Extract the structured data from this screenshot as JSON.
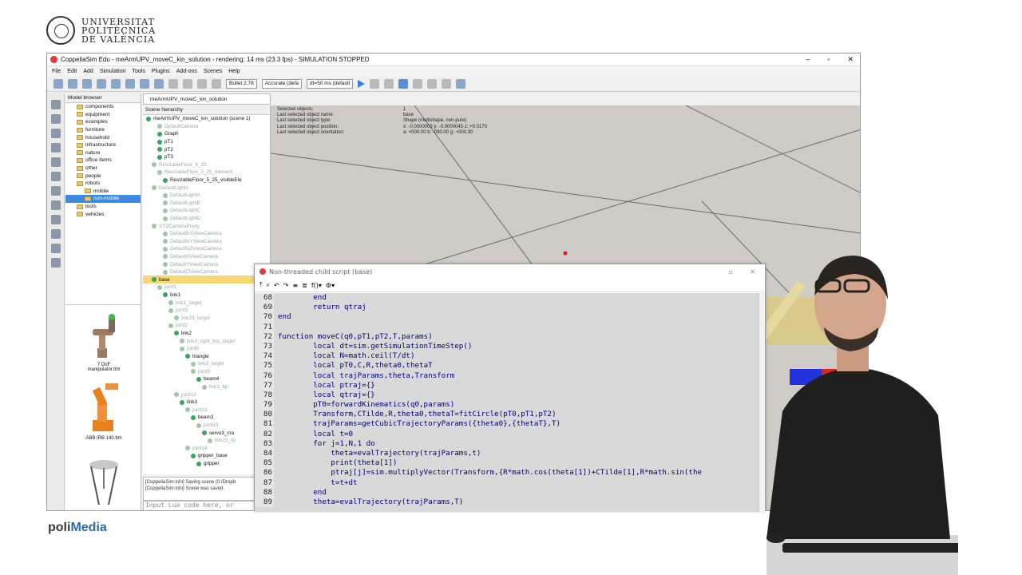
{
  "brand": {
    "university_lines": [
      "UNIVERSITAT",
      "POLITÈCNICA",
      "DE VALÈNCIA"
    ],
    "polimedia_a": "poli",
    "polimedia_b": "Media"
  },
  "window": {
    "title": "CoppeliaSim Edu - meArmUPV_moveC_kin_solution - rendering: 14 ms (23.3 fps) - SIMULATION STOPPED"
  },
  "menu": [
    "File",
    "Edit",
    "Add",
    "Simulation",
    "Tools",
    "Plugins",
    "Add-ons",
    "Scenes",
    "Help"
  ],
  "toolbar": {
    "engine": "Bullet 2.78",
    "accuracy": "Accurate (defa",
    "dt": "dt=50 ms (default"
  },
  "model_browser": {
    "title": "Model browser",
    "items": [
      {
        "label": "components",
        "indent": 0
      },
      {
        "label": "equipment",
        "indent": 0
      },
      {
        "label": "examples",
        "indent": 0
      },
      {
        "label": "furniture",
        "indent": 0
      },
      {
        "label": "household",
        "indent": 0
      },
      {
        "label": "infrastructure",
        "indent": 0
      },
      {
        "label": "nature",
        "indent": 0
      },
      {
        "label": "office items",
        "indent": 0
      },
      {
        "label": "other",
        "indent": 0
      },
      {
        "label": "people",
        "indent": 0
      },
      {
        "label": "robots",
        "indent": 0
      },
      {
        "label": "mobile",
        "indent": 1
      },
      {
        "label": "non-mobile",
        "indent": 1,
        "selected": true
      },
      {
        "label": "tools",
        "indent": 0
      },
      {
        "label": "vehicles",
        "indent": 0
      }
    ],
    "thumbs": [
      "7 DoF manipulator.ttm",
      "ABB IRB 140.ttm"
    ]
  },
  "scene": {
    "tab": "meArmUPV_moveC_kin_solution",
    "hierarchy_title": "Scene hierarchy",
    "rows": [
      {
        "label": "meArmUPV_moveC_kin_solution (scene 1)",
        "indent": 0
      },
      {
        "label": "DefaultCamera",
        "indent": 2,
        "faded": true
      },
      {
        "label": "Graph",
        "indent": 2
      },
      {
        "label": "pT1",
        "indent": 2
      },
      {
        "label": "pT2",
        "indent": 2
      },
      {
        "label": "pT3",
        "indent": 2
      },
      {
        "label": "ResizableFloor_5_25",
        "indent": 1,
        "faded": true
      },
      {
        "label": "ResizableFloor_5_25_element",
        "indent": 2,
        "faded": true
      },
      {
        "label": "ResizableFloor_5_25_visibleEle",
        "indent": 3
      },
      {
        "label": "DefaultLights",
        "indent": 1,
        "faded": true
      },
      {
        "label": "DefaultLightA",
        "indent": 3,
        "faded": true
      },
      {
        "label": "DefaultLightB",
        "indent": 3,
        "faded": true
      },
      {
        "label": "DefaultLightC",
        "indent": 3,
        "faded": true
      },
      {
        "label": "DefaultLightD",
        "indent": 3,
        "faded": true
      },
      {
        "label": "XYZCameraProxy",
        "indent": 1,
        "faded": true
      },
      {
        "label": "DefaultNXViewCamera",
        "indent": 3,
        "faded": true
      },
      {
        "label": "DefaultNYViewCamera",
        "indent": 3,
        "faded": true
      },
      {
        "label": "DefaultNZViewCamera",
        "indent": 3,
        "faded": true
      },
      {
        "label": "DefaultXViewCamera",
        "indent": 3,
        "faded": true
      },
      {
        "label": "DefaultYViewCamera",
        "indent": 3,
        "faded": true
      },
      {
        "label": "DefaultZViewCamera",
        "indent": 3,
        "faded": true
      },
      {
        "label": "base",
        "indent": 1,
        "selected": true
      },
      {
        "label": "joint1",
        "indent": 2,
        "faded": true
      },
      {
        "label": "link1",
        "indent": 3
      },
      {
        "label": "link1_target",
        "indent": 4,
        "faded": true
      },
      {
        "label": "joint3",
        "indent": 4,
        "faded": true
      },
      {
        "label": "link23_target",
        "indent": 5,
        "faded": true
      },
      {
        "label": "joint2",
        "indent": 4,
        "faded": true
      },
      {
        "label": "link2",
        "indent": 5
      },
      {
        "label": "link3_right_top_target",
        "indent": 6,
        "faded": true
      },
      {
        "label": "joint8",
        "indent": 6,
        "faded": true
      },
      {
        "label": "triangle",
        "indent": 7
      },
      {
        "label": "link3_target",
        "indent": 8,
        "faded": true
      },
      {
        "label": "joint5",
        "indent": 8,
        "faded": true
      },
      {
        "label": "beam4",
        "indent": 9
      },
      {
        "label": "link1_tip",
        "indent": 10,
        "faded": true
      },
      {
        "label": "joint12",
        "indent": 5,
        "faded": true
      },
      {
        "label": "link3",
        "indent": 6
      },
      {
        "label": "joint13",
        "indent": 7,
        "faded": true
      },
      {
        "label": "beam3",
        "indent": 8
      },
      {
        "label": "joint15",
        "indent": 9,
        "faded": true
      },
      {
        "label": "servo3_cra",
        "indent": 10
      },
      {
        "label": "link23_tip",
        "indent": 11,
        "faded": true
      },
      {
        "label": "joint14",
        "indent": 7,
        "faded": true
      },
      {
        "label": "gripper_base",
        "indent": 8
      },
      {
        "label": "gripper",
        "indent": 9
      }
    ],
    "console": [
      "[CoppeliaSim:info]    Saving scene (0:/Dropb",
      "[CoppeliaSim:info]    Scene was saved."
    ],
    "lua_placeholder": "Input Lua code here, or"
  },
  "object_info": [
    [
      "Selected objects:",
      "1"
    ],
    [
      "Last selected object name:",
      "base"
    ],
    [
      "Last selected object type:",
      "Shape (multishape, non-pure)"
    ],
    [
      "Last selected object position:",
      "x: -0.0000003   y: -0.0000045   z: +0.0170"
    ],
    [
      "Last selected object orientation:",
      "a: +000.00   b: -090.00   g: +000.00"
    ]
  ],
  "script": {
    "title": "Non-threaded child script (base)",
    "lines": [
      {
        "n": "68",
        "t": "        end"
      },
      {
        "n": "69",
        "t": "        return qtraj"
      },
      {
        "n": "70",
        "t": "end"
      },
      {
        "n": "71",
        "t": ""
      },
      {
        "n": "72",
        "t": "function moveC(q0,pT1,pT2,T,params)"
      },
      {
        "n": "73",
        "t": "        local dt=sim.getSimulationTimeStep()"
      },
      {
        "n": "74",
        "t": "        local N=math.ceil(T/dt)"
      },
      {
        "n": "75",
        "t": "        local pT0,C,R,theta0,thetaT"
      },
      {
        "n": "76",
        "t": "        local trajParams,theta,Transform"
      },
      {
        "n": "77",
        "t": "        local ptraj={}"
      },
      {
        "n": "78",
        "t": "        local qtraj={}"
      },
      {
        "n": "79",
        "t": "        pT0=forwardKinematics(q0,params)"
      },
      {
        "n": "80",
        "t": "        Transform,CTilde,R,theta0,thetaT=fitCircle(pT0,pT1,pT2)"
      },
      {
        "n": "81",
        "t": "        trajParams=getCubicTrajectoryParams({theta0},{thetaT},T)"
      },
      {
        "n": "82",
        "t": "        local t=0"
      },
      {
        "n": "83",
        "t": "        for j=1,N,1 do"
      },
      {
        "n": "84",
        "t": "            theta=evalTrajectory(trajParams,t)"
      },
      {
        "n": "85",
        "t": "            print(theta[1])"
      },
      {
        "n": "86",
        "t": "            ptraj[j]=sim.multiplyVector(Transform,{R*math.cos(theta[1])+CTilde[1],R*math.sin(the"
      },
      {
        "n": "87",
        "t": "            t=t+dt"
      },
      {
        "n": "88",
        "t": "        end"
      },
      {
        "n": "89",
        "t": "        theta=evalTrajectory(trajParams,T)"
      }
    ]
  }
}
